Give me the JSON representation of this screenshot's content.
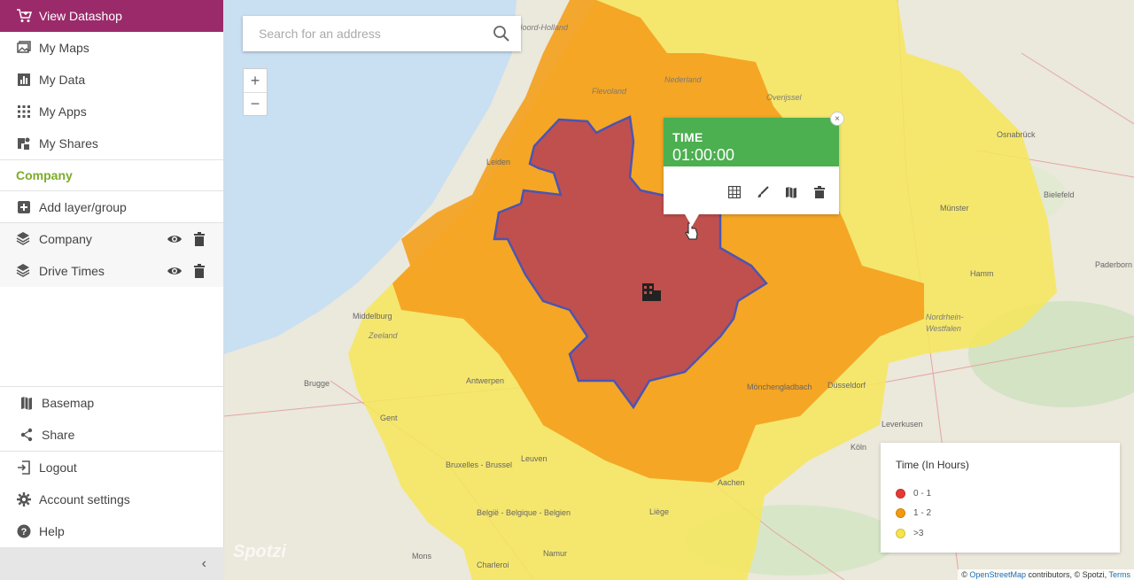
{
  "sidebar": {
    "datashop_label": "View Datashop",
    "nav": [
      {
        "label": "My Maps",
        "icon": "image-icon"
      },
      {
        "label": "My Data",
        "icon": "bar-chart-icon"
      },
      {
        "label": "My Apps",
        "icon": "grid-icon"
      },
      {
        "label": "My Shares",
        "icon": "share-folder-icon"
      }
    ],
    "section_title": "Company",
    "add_layer_label": "Add layer/group",
    "layers": [
      {
        "label": "Company"
      },
      {
        "label": "Drive Times"
      }
    ],
    "bottom": [
      {
        "label": "Basemap",
        "icon": "map-icon"
      },
      {
        "label": "Share",
        "icon": "share-icon"
      }
    ],
    "account": [
      {
        "label": "Logout",
        "icon": "logout-icon"
      },
      {
        "label": "Account settings",
        "icon": "gear-icon"
      },
      {
        "label": "Help",
        "icon": "help-icon"
      }
    ],
    "collapse_glyph": "‹"
  },
  "map": {
    "search_placeholder": "Search for an address",
    "zoom_in": "+",
    "zoom_out": "−",
    "popup": {
      "title": "TIME",
      "value": "01:00:00",
      "close": "×"
    },
    "legend": {
      "title": "Time (In Hours)",
      "items": [
        {
          "label": "0 - 1",
          "color": "#e53935"
        },
        {
          "label": "1 - 2",
          "color": "#f29b0f"
        },
        {
          "label": ">3",
          "color": "#f7e34a"
        }
      ]
    },
    "attribution": {
      "prefix": "©",
      "osm": "OpenStreetMap",
      "middle": "contributors, © Spotzi,",
      "terms": "Terms"
    },
    "watermark": "Spotzi",
    "labels": [
      "Noord-Holland",
      "Flevoland",
      "Nederland",
      "Overijssel",
      "Osnabrück",
      "Bielefeld",
      "Münster",
      "Paderborn",
      "Hamm",
      "Leiden",
      "Middelburg",
      "Zeeland",
      "Brugge",
      "Gent",
      "Antwerpen",
      "Düsseldorf",
      "Nordrhein-Westfalen",
      "Mönchengladbach",
      "Aachen",
      "Köln",
      "Leverkusen",
      "Bruxelles - Brussel",
      "Leuven",
      "België - Belgique - Belgien",
      "Liège",
      "Namur",
      "Mons",
      "Charleroi"
    ]
  },
  "colors": {
    "accent": "#9b2a6b",
    "company": "#7cab2a",
    "popup_green": "#4caf50",
    "zone_1": "#c0504d",
    "zone_2": "#f4a11e",
    "zone_3": "#f7e65a",
    "sea": "#c9dff2"
  }
}
